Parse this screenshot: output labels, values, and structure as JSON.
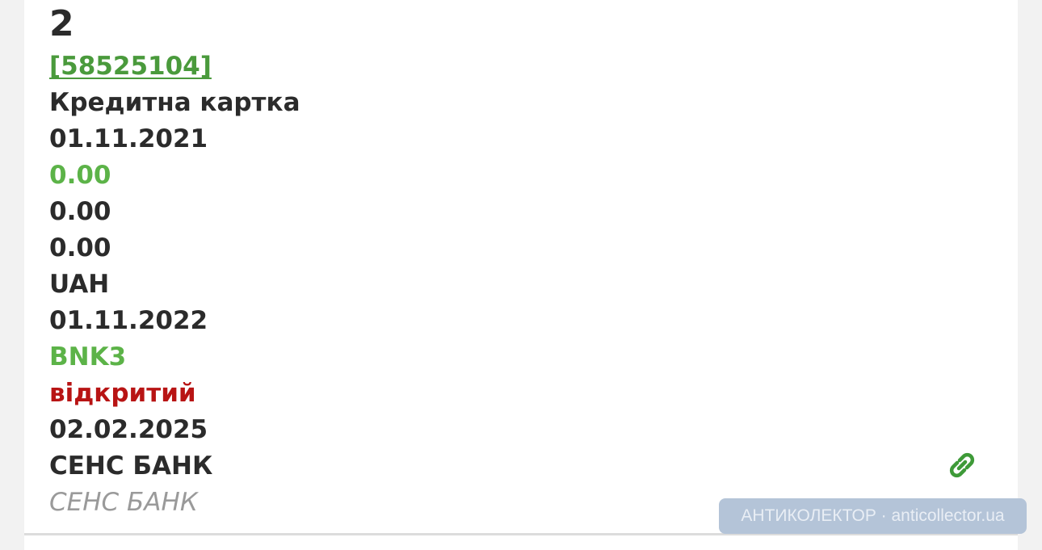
{
  "record": {
    "number": "2",
    "contract_id": "[58525104]",
    "product_type": "Кредитна картка",
    "open_date": "01.11.2021",
    "amount_green": "0.00",
    "amount_2": "0.00",
    "amount_3": "0.00",
    "currency": "UAH",
    "close_date": "01.11.2022",
    "source_code": "BNK3",
    "status": "відкритий",
    "update_date": "02.02.2025",
    "creditor": "СЕНС БАНК",
    "creditor_original": "СЕНС БАНК"
  },
  "icons": {
    "link_icon": "link-chain-icon"
  },
  "watermark": {
    "text": "АНТИКОЛЕКТОР · anticollector.ua"
  },
  "colors": {
    "green_link": "#4a9a3c",
    "green_value": "#5cb348",
    "status_red": "#b81414",
    "muted_gray": "#9a9a9a"
  }
}
